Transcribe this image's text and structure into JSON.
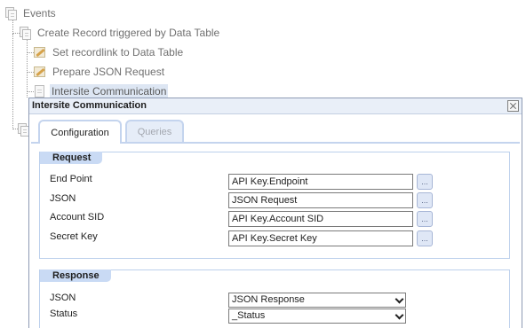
{
  "tree": {
    "root": {
      "label": "Events",
      "icon": "document-stack-icon"
    },
    "event": {
      "label": "Create Record triggered by Data Table",
      "icon": "document-stack-icon"
    },
    "actions": [
      {
        "label": "Set recordlink to Data Table",
        "icon": "pencil-icon"
      },
      {
        "label": "Prepare JSON Request",
        "icon": "pencil-icon"
      },
      {
        "label": "Intersite Communication",
        "icon": "page-icon",
        "selected": true
      }
    ]
  },
  "dialog": {
    "title": "Intersite Communication",
    "close_icon": "close-icon",
    "tabs": [
      {
        "label": "Configuration",
        "active": true
      },
      {
        "label": "Queries",
        "active": false
      }
    ],
    "request": {
      "header": "Request",
      "fields": [
        {
          "label": "End Point",
          "value": "API Key.Endpoint",
          "button": "..."
        },
        {
          "label": "JSON",
          "value": "JSON Request",
          "button": "..."
        },
        {
          "label": "Account SID",
          "value": "API Key.Account SID",
          "button": "..."
        },
        {
          "label": "Secret Key",
          "value": "API Key.Secret Key",
          "button": "..."
        }
      ]
    },
    "response": {
      "header": "Response",
      "fields": [
        {
          "label": "JSON",
          "selected": "JSON Response"
        },
        {
          "label": "Status",
          "selected": "_Status"
        }
      ]
    }
  },
  "colors": {
    "tab_border": "#c4d4ee",
    "section_header": "#c9daf4",
    "dialog_titlebar": "#e9eff8",
    "tree_text": "#707070",
    "selected_node_bg": "#dde6f3"
  }
}
